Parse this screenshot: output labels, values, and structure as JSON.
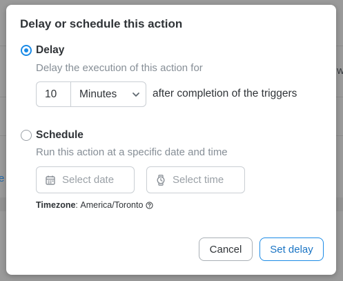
{
  "background": {
    "right_fragment": "w",
    "left_fragment": "e"
  },
  "modal": {
    "title": "Delay or schedule this action",
    "delay_option": {
      "label": "Delay",
      "selected": true,
      "description": "Delay the execution of this action for",
      "amount_value": "10",
      "unit_value": "Minutes",
      "suffix": "after completion of the triggers"
    },
    "schedule_option": {
      "label": "Schedule",
      "selected": false,
      "description": "Run this action at a specific date and time",
      "date_placeholder": "Select date",
      "time_placeholder": "Select time"
    },
    "timezone": {
      "label": "Timezone",
      "separator": ":",
      "value": "America/Toronto"
    },
    "buttons": {
      "cancel": "Cancel",
      "confirm": "Set delay"
    },
    "colors": {
      "accent": "#1a8ae6",
      "muted_text": "#868e96",
      "primary_text": "#2f3337"
    },
    "icons": [
      "calendar-icon",
      "watch-icon",
      "help-icon",
      "chevron-down-icon"
    ]
  }
}
